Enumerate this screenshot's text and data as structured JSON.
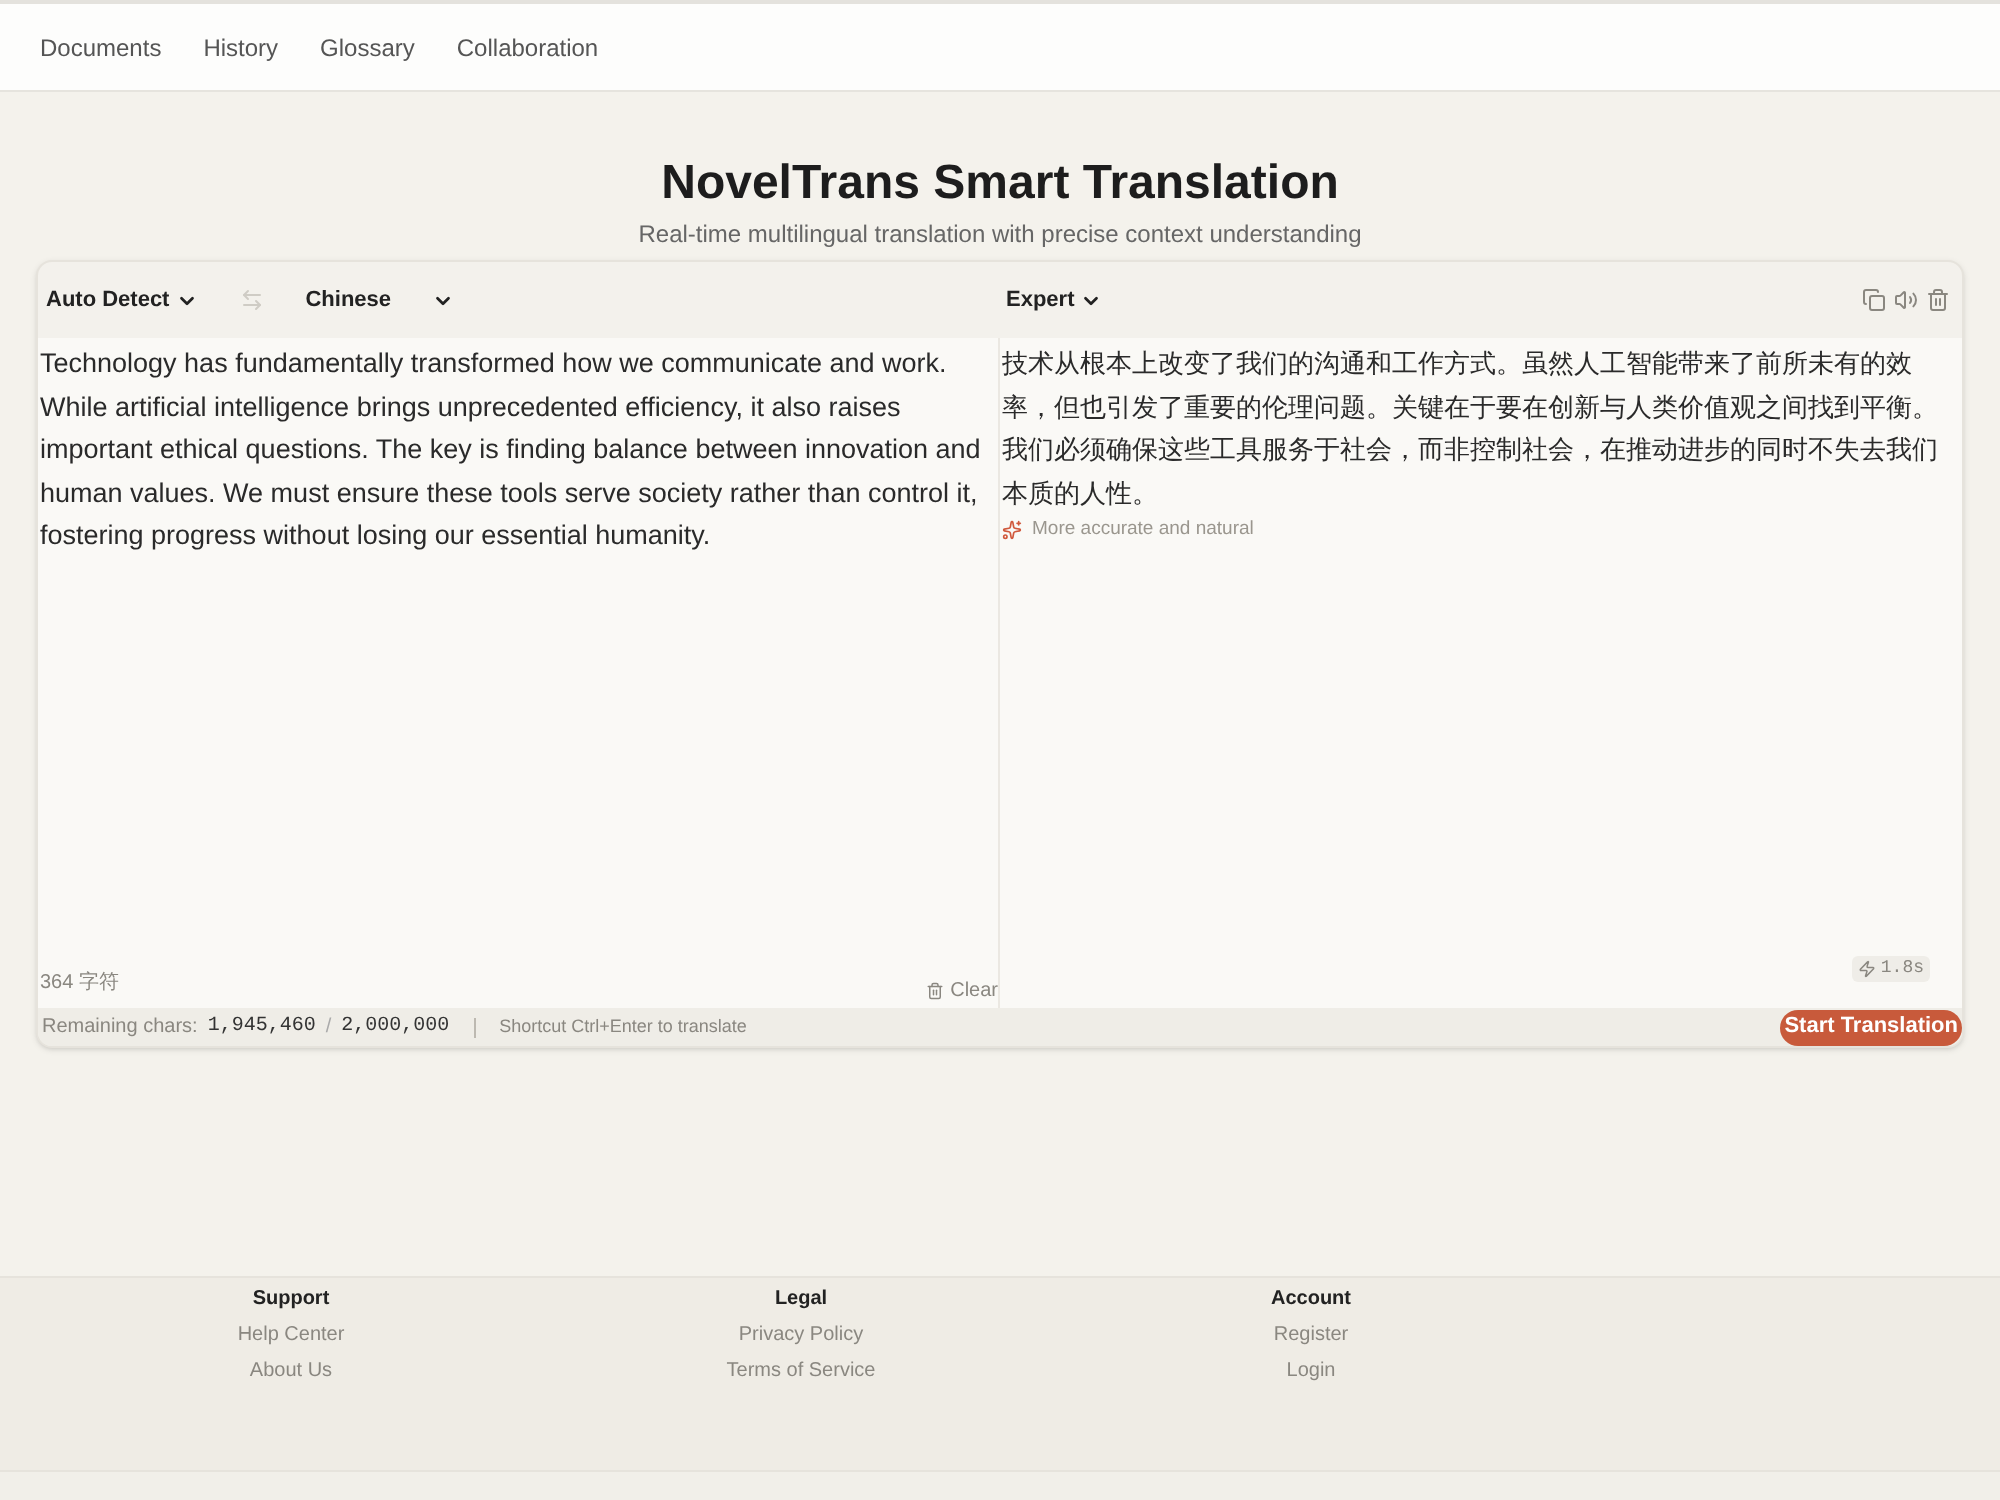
{
  "nav": {
    "items": [
      {
        "label": "Documents"
      },
      {
        "label": "History"
      },
      {
        "label": "Glossary"
      },
      {
        "label": "Collaboration"
      }
    ]
  },
  "header": {
    "title": "NovelTrans Smart Translation",
    "subtitle": "Real-time multilingual translation with precise context understanding"
  },
  "translator": {
    "source": {
      "language": "Auto Detect",
      "swap": {
        "disabled": true
      },
      "target_language": "Chinese",
      "text": "Technology has fundamentally transformed how we communicate and work. While artificial intelligence brings unprecedented efficiency, it also raises important ethical questions. The key is finding balance between innovation and human values. We must ensure these tools serve society rather than control it, fostering progress without losing our essential humanity.",
      "char_count": "364 字符",
      "clear": "Clear"
    },
    "output": {
      "mode": "Expert",
      "text": "技术从根本上改变了我们的沟通和工作方式。虽然人工智能带来了前所未有的效率，但也引发了重要的伦理问题。关键在于要在创新与人类价值观之间找到平衡。我们必须确保这些工具服务于社会，而非控制社会，在推动进步的同时不失去我们本质的人性。",
      "note": "More accurate and natural",
      "time": "1.8s"
    },
    "bottom": {
      "remaining_label": "Remaining chars:",
      "remaining": "1,945,460",
      "separator": "/",
      "total": "2,000,000",
      "shortcut": "Shortcut Ctrl+Enter to translate",
      "button": "Start Translation"
    }
  },
  "footer": {
    "columns": [
      {
        "heading": "Support",
        "links": [
          "Help Center",
          "About Us"
        ]
      },
      {
        "heading": "Legal",
        "links": [
          "Privacy Policy",
          "Terms of Service"
        ]
      },
      {
        "heading": "Account",
        "links": [
          "Register",
          "Login"
        ]
      }
    ]
  }
}
